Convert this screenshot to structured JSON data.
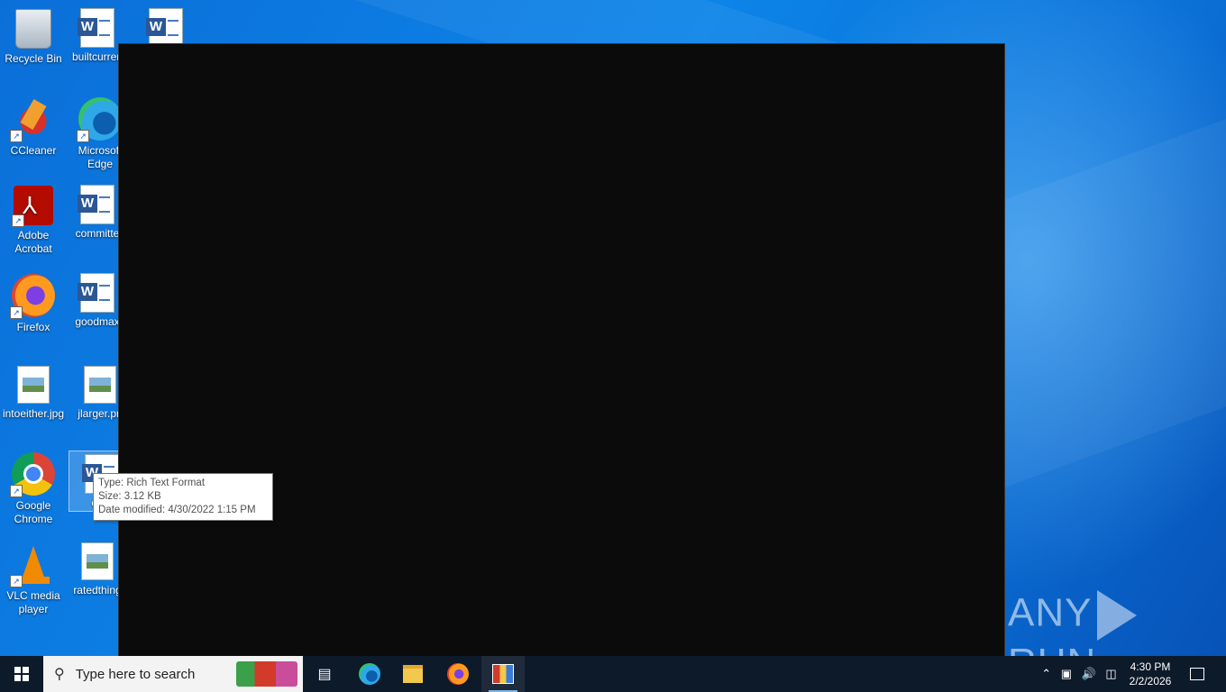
{
  "desktop": {
    "icons": [
      {
        "label": "Recycle Bin"
      },
      {
        "label": "builtcurren"
      },
      {
        "label": ""
      },
      {
        "label": "CCleaner"
      },
      {
        "label": "Microsoft Edge"
      },
      {
        "label": "Adobe Acrobat"
      },
      {
        "label": "committe"
      },
      {
        "label": "Firefox"
      },
      {
        "label": "goodmax"
      },
      {
        "label": "intoeither.jpg"
      },
      {
        "label": "jlarger.pn"
      },
      {
        "label": "Google Chrome"
      },
      {
        "label": "otha"
      },
      {
        "label": "VLC media player"
      },
      {
        "label": "ratedthing"
      }
    ]
  },
  "tooltip": {
    "type": "Type: Rich Text Format",
    "size": "Size: 3.12 KB",
    "modified": "Date modified: 4/30/2022 1:15 PM"
  },
  "watermark": {
    "left": "ANY",
    "right": "RUN"
  },
  "taskbar": {
    "search_placeholder": "Type here to search",
    "clock_time": "4:30 PM",
    "clock_date": "2/2/2026",
    "icons": [
      "windows-icon",
      "search-icon",
      "task-view-icon",
      "edge-icon",
      "file-explorer-icon",
      "firefox-icon",
      "app-icon",
      "chevron-up-icon",
      "meet-icon",
      "volume-icon",
      "network-icon",
      "notification-icon"
    ]
  },
  "colors": {
    "taskbar": "#0d1a2a",
    "desktop": "#0c84e8",
    "window": "#0b0b0b"
  }
}
